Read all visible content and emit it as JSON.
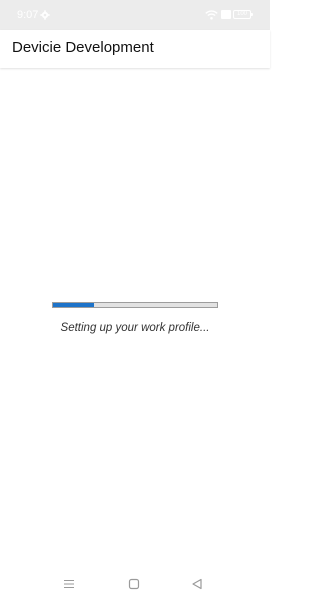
{
  "status_bar": {
    "time": "9:07",
    "battery_level": "100",
    "icons": [
      "gear-icon",
      "wifi-icon",
      "cast-icon",
      "battery-icon"
    ]
  },
  "app_bar": {
    "title": "Devicie Development"
  },
  "main": {
    "progress_fraction": 0.25,
    "message": "Setting up your work profile..."
  },
  "navigation_bar": {
    "icons": [
      "menu-lines-icon",
      "home-square-icon",
      "back-triangle-icon"
    ]
  },
  "colors": {
    "progress_fill": "#1d73c9",
    "progress_track": "#e2e2e2",
    "status_bar_background": "#ececec"
  }
}
